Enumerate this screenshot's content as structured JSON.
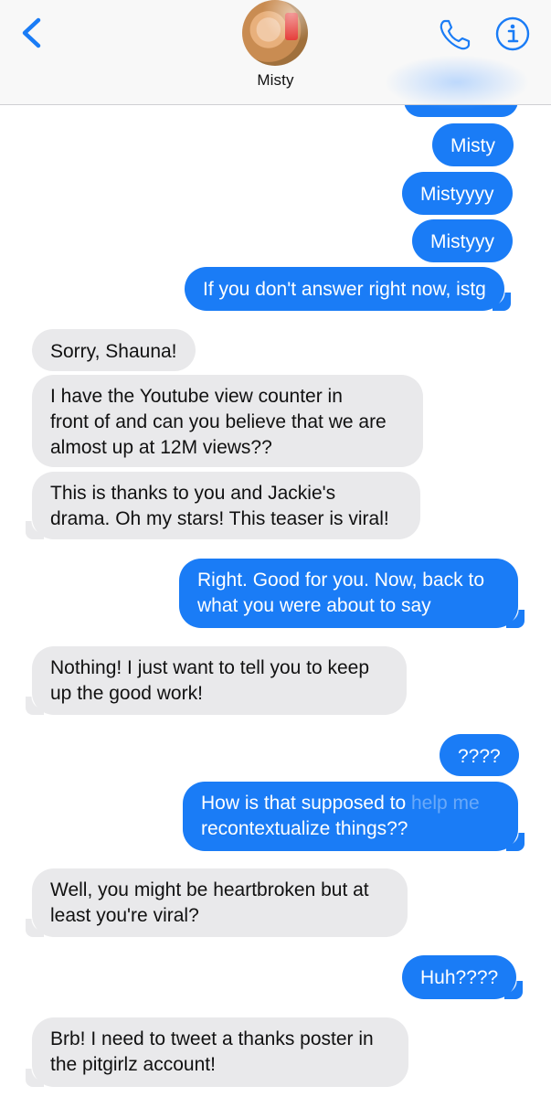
{
  "header": {
    "contact_name": "Misty",
    "back_icon": "chevron-left-icon",
    "call_icon": "phone-icon",
    "info_icon": "info-icon",
    "accent": "#1a7cf6"
  },
  "messages": [
    {
      "dir": "out",
      "text": "Misty"
    },
    {
      "dir": "out",
      "text": "Mistyyyy"
    },
    {
      "dir": "out",
      "text": "Mistyyy"
    },
    {
      "dir": "out",
      "text": "If you don't answer right now, istg"
    },
    {
      "dir": "in",
      "text": "Sorry, Shauna!"
    },
    {
      "dir": "in",
      "lines": [
        "I have the Youtube view counter in",
        "front of and can you believe that we are",
        "almost up at 12M views??"
      ]
    },
    {
      "dir": "in",
      "lines": [
        "This is thanks to you and Jackie's",
        "drama. Oh my stars! This teaser is viral!"
      ]
    },
    {
      "dir": "out",
      "lines": [
        "Right. Good for you. Now, back to",
        "what you were about to say"
      ]
    },
    {
      "dir": "in",
      "lines": [
        "Nothing! I just want to tell you to keep",
        "up the good work!"
      ]
    },
    {
      "dir": "out",
      "text": "????"
    },
    {
      "dir": "out",
      "lines": [
        "How is that supposed to help me",
        "recontextualize things??"
      ],
      "faded_part": "help me"
    },
    {
      "dir": "in",
      "lines": [
        "Well, you might be heartbroken but at",
        "least you're viral?"
      ]
    },
    {
      "dir": "out",
      "text": "Huh????"
    },
    {
      "dir": "in",
      "lines": [
        "Brb! I need to tweet a thanks poster in",
        "the pitgirlz account!"
      ]
    }
  ]
}
